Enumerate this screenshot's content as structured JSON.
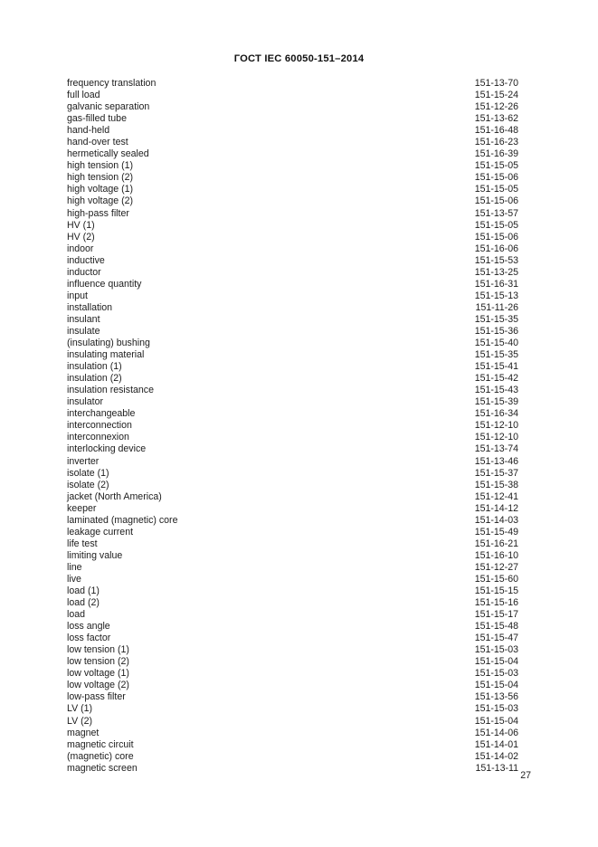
{
  "document": {
    "header": "ГОСТ IEC 60050-151–2014",
    "page_number": "27"
  },
  "index": {
    "entries": [
      {
        "term": "frequency translation",
        "ref": "151-13-70"
      },
      {
        "term": "full load",
        "ref": "151-15-24"
      },
      {
        "term": "galvanic separation",
        "ref": "151-12-26"
      },
      {
        "term": "gas-filled tube",
        "ref": "151-13-62"
      },
      {
        "term": "hand-held",
        "ref": "151-16-48"
      },
      {
        "term": "hand-over test",
        "ref": "151-16-23"
      },
      {
        "term": "hermetically sealed",
        "ref": "151-16-39"
      },
      {
        "term": "high tension (1)",
        "ref": "151-15-05"
      },
      {
        "term": "high tension (2)",
        "ref": "151-15-06"
      },
      {
        "term": "high voltage (1)",
        "ref": "151-15-05"
      },
      {
        "term": "high voltage (2)",
        "ref": "151-15-06"
      },
      {
        "term": "high-pass filter",
        "ref": "151-13-57"
      },
      {
        "term": "HV (1)",
        "ref": "151-15-05"
      },
      {
        "term": "HV (2)",
        "ref": "151-15-06"
      },
      {
        "term": "indoor",
        "ref": "151-16-06"
      },
      {
        "term": "inductive",
        "ref": "151-15-53"
      },
      {
        "term": "inductor",
        "ref": "151-13-25"
      },
      {
        "term": "influence quantity",
        "ref": "151-16-31"
      },
      {
        "term": "input",
        "ref": "151-15-13"
      },
      {
        "term": "installation",
        "ref": "151-11-26"
      },
      {
        "term": "insulant",
        "ref": "151-15-35"
      },
      {
        "term": "insulate",
        "ref": "151-15-36"
      },
      {
        "term": "(insulating) bushing",
        "ref": "151-15-40"
      },
      {
        "term": "insulating material",
        "ref": "151-15-35"
      },
      {
        "term": "insulation (1)",
        "ref": "151-15-41"
      },
      {
        "term": "insulation (2)",
        "ref": "151-15-42"
      },
      {
        "term": "insulation resistance",
        "ref": "151-15-43"
      },
      {
        "term": "insulator",
        "ref": "151-15-39"
      },
      {
        "term": "interchangeable",
        "ref": "151-16-34"
      },
      {
        "term": "interconnection",
        "ref": "151-12-10"
      },
      {
        "term": "interconnexion",
        "ref": "151-12-10"
      },
      {
        "term": "interlocking device",
        "ref": "151-13-74"
      },
      {
        "term": "inverter",
        "ref": "151-13-46"
      },
      {
        "term": "isolate (1)",
        "ref": "151-15-37"
      },
      {
        "term": "isolate (2)",
        "ref": "151-15-38"
      },
      {
        "term": "jacket (North America)",
        "ref": "151-12-41"
      },
      {
        "term": "keeper",
        "ref": "151-14-12"
      },
      {
        "term": "laminated (magnetic) core",
        "ref": "151-14-03"
      },
      {
        "term": "leakage current",
        "ref": "151-15-49"
      },
      {
        "term": "life test",
        "ref": "151-16-21"
      },
      {
        "term": "limiting value",
        "ref": "151-16-10"
      },
      {
        "term": "line",
        "ref": "151-12-27"
      },
      {
        "term": "live",
        "ref": "151-15-60"
      },
      {
        "term": "load (1)",
        "ref": "151-15-15"
      },
      {
        "term": "load (2)",
        "ref": "151-15-16"
      },
      {
        "term": "load",
        "ref": "151-15-17"
      },
      {
        "term": "loss angle",
        "ref": "151-15-48"
      },
      {
        "term": "loss factor",
        "ref": "151-15-47"
      },
      {
        "term": "low tension (1)",
        "ref": "151-15-03"
      },
      {
        "term": "low tension (2)",
        "ref": "151-15-04"
      },
      {
        "term": "low voltage (1)",
        "ref": "151-15-03"
      },
      {
        "term": "low voltage (2)",
        "ref": "151-15-04"
      },
      {
        "term": "low-pass filter",
        "ref": "151-13-56"
      },
      {
        "term": "LV (1)",
        "ref": "151-15-03"
      },
      {
        "term": "LV (2)",
        "ref": "151-15-04"
      },
      {
        "term": "magnet",
        "ref": "151-14-06"
      },
      {
        "term": "magnetic circuit",
        "ref": "151-14-01"
      },
      {
        "term": "(magnetic) core",
        "ref": "151-14-02"
      },
      {
        "term": "magnetic screen",
        "ref": "151-13-11"
      }
    ]
  }
}
